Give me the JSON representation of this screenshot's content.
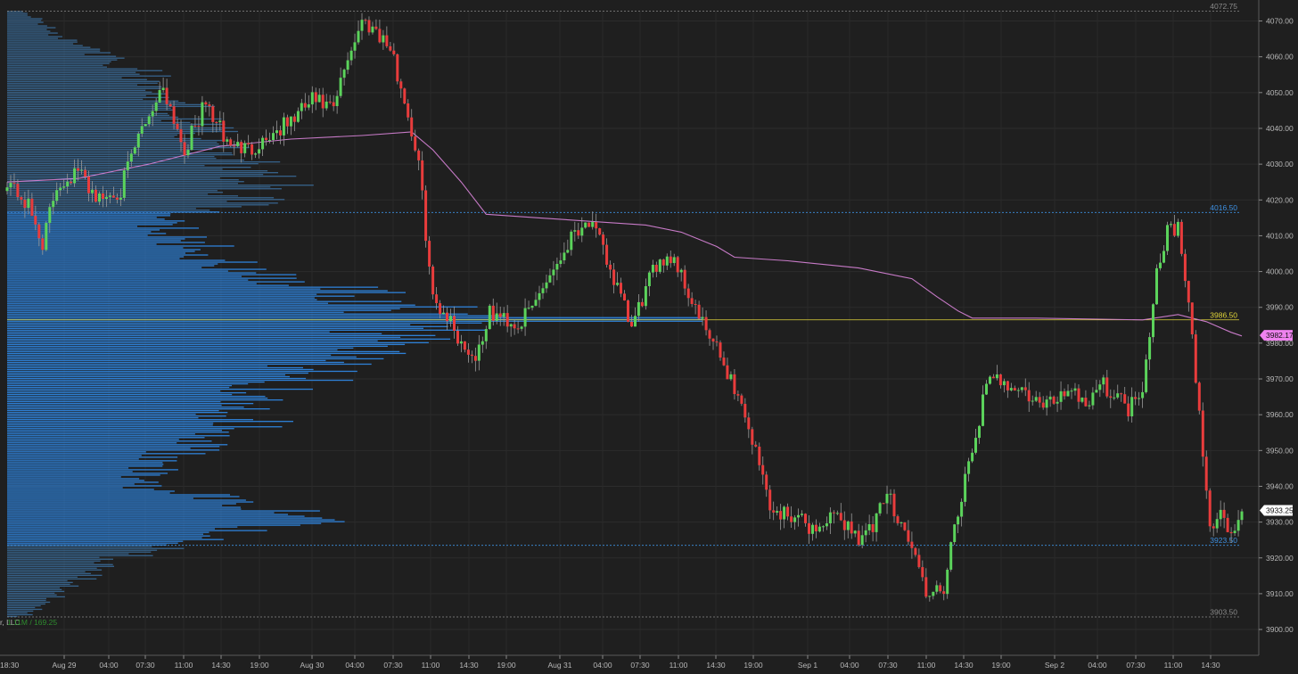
{
  "chart_data": {
    "type": "candlestick",
    "y_range": [
      3898,
      4073
    ],
    "y_ticks": [
      {
        "v": 4070,
        "label": "4070.00"
      },
      {
        "v": 4060,
        "label": "4060.00"
      },
      {
        "v": 4050,
        "label": "4050.00"
      },
      {
        "v": 4040,
        "label": "4040.00"
      },
      {
        "v": 4030,
        "label": "4030.00"
      },
      {
        "v": 4020,
        "label": "4020.00"
      },
      {
        "v": 4010,
        "label": "4010.00"
      },
      {
        "v": 4000,
        "label": "4000.00"
      },
      {
        "v": 3990,
        "label": "3990.00"
      },
      {
        "v": 3980,
        "label": "3980.00"
      },
      {
        "v": 3970,
        "label": "3970.00"
      },
      {
        "v": 3960,
        "label": "3960.00"
      },
      {
        "v": 3950,
        "label": "3950.00"
      },
      {
        "v": 3940,
        "label": "3940.00"
      },
      {
        "v": 3930,
        "label": "3930.00"
      },
      {
        "v": 3920,
        "label": "3920.00"
      },
      {
        "v": 3910,
        "label": "3910.00"
      },
      {
        "v": 3900,
        "label": "3900.00"
      }
    ],
    "x_labels": [
      "Aug 29",
      "04:00",
      "07:30",
      "11:00",
      "14:30",
      "19:00",
      "Aug 30",
      "04:00",
      "07:30",
      "11:00",
      "14:30",
      "19:00",
      "Aug 31",
      "04:00",
      "07:30",
      "11:00",
      "14:30",
      "19:00",
      "Sep 1",
      "04:00",
      "07:30",
      "11:00",
      "14:30",
      "19:00",
      "Sep 2",
      "04:00",
      "07:30",
      "11:00",
      "14:30"
    ],
    "x_start_label": "18:30",
    "levels": [
      {
        "name": "high",
        "value": 4072.75,
        "label": "4072.75",
        "color": "#8a8a8a"
      },
      {
        "name": "value-area-high",
        "value": 4016.5,
        "label": "4016.50",
        "color": "#3d8fe0"
      },
      {
        "name": "point-of-control",
        "value": 3986.5,
        "label": "3986.50",
        "color": "#e0d43a"
      },
      {
        "name": "value-area-low",
        "value": 3923.5,
        "label": "3923.50",
        "color": "#3d8fe0"
      },
      {
        "name": "low",
        "value": 3903.5,
        "label": "3903.50",
        "color": "#8a8a8a"
      }
    ],
    "last_prices": [
      {
        "value": 3982.17,
        "label": "3982.17",
        "color": "#ee82ee"
      },
      {
        "value": 3933.25,
        "label": "3933.25",
        "color": "#ffffff"
      }
    ],
    "anchors": [
      {
        "i": 0,
        "p": 4026
      },
      {
        "i": 6,
        "p": 4018
      },
      {
        "i": 10,
        "p": 4008
      },
      {
        "i": 14,
        "p": 4024
      },
      {
        "i": 20,
        "p": 4028
      },
      {
        "i": 26,
        "p": 4020
      },
      {
        "i": 32,
        "p": 4023
      },
      {
        "i": 38,
        "p": 4040
      },
      {
        "i": 44,
        "p": 4052
      },
      {
        "i": 50,
        "p": 4034
      },
      {
        "i": 56,
        "p": 4047
      },
      {
        "i": 62,
        "p": 4036
      },
      {
        "i": 68,
        "p": 4034
      },
      {
        "i": 74,
        "p": 4038
      },
      {
        "i": 80,
        "p": 4042
      },
      {
        "i": 86,
        "p": 4048
      },
      {
        "i": 92,
        "p": 4045
      },
      {
        "i": 96,
        "p": 4060
      },
      {
        "i": 100,
        "p": 4070
      },
      {
        "i": 104,
        "p": 4068
      },
      {
        "i": 108,
        "p": 4062
      },
      {
        "i": 112,
        "p": 4048
      },
      {
        "i": 116,
        "p": 4030
      },
      {
        "i": 120,
        "p": 3992
      },
      {
        "i": 124,
        "p": 3988
      },
      {
        "i": 128,
        "p": 3980
      },
      {
        "i": 132,
        "p": 3976
      },
      {
        "i": 136,
        "p": 3988
      },
      {
        "i": 140,
        "p": 3987
      },
      {
        "i": 144,
        "p": 3985
      },
      {
        "i": 148,
        "p": 3990
      },
      {
        "i": 152,
        "p": 3998
      },
      {
        "i": 156,
        "p": 4004
      },
      {
        "i": 160,
        "p": 4012
      },
      {
        "i": 164,
        "p": 4014
      },
      {
        "i": 168,
        "p": 4006
      },
      {
        "i": 172,
        "p": 3995
      },
      {
        "i": 176,
        "p": 3984
      },
      {
        "i": 180,
        "p": 3995
      },
      {
        "i": 184,
        "p": 4004
      },
      {
        "i": 188,
        "p": 4004
      },
      {
        "i": 192,
        "p": 3994
      },
      {
        "i": 196,
        "p": 3985
      },
      {
        "i": 200,
        "p": 3978
      },
      {
        "i": 204,
        "p": 3970
      },
      {
        "i": 208,
        "p": 3960
      },
      {
        "i": 212,
        "p": 3946
      },
      {
        "i": 216,
        "p": 3932
      },
      {
        "i": 220,
        "p": 3933
      },
      {
        "i": 224,
        "p": 3930
      },
      {
        "i": 228,
        "p": 3928
      },
      {
        "i": 232,
        "p": 3931
      },
      {
        "i": 236,
        "p": 3930
      },
      {
        "i": 240,
        "p": 3926
      },
      {
        "i": 244,
        "p": 3928
      },
      {
        "i": 248,
        "p": 3938
      },
      {
        "i": 252,
        "p": 3930
      },
      {
        "i": 256,
        "p": 3920
      },
      {
        "i": 260,
        "p": 3908
      },
      {
        "i": 264,
        "p": 3912
      },
      {
        "i": 268,
        "p": 3932
      },
      {
        "i": 272,
        "p": 3950
      },
      {
        "i": 276,
        "p": 3968
      },
      {
        "i": 280,
        "p": 3970
      },
      {
        "i": 284,
        "p": 3968
      },
      {
        "i": 288,
        "p": 3965
      },
      {
        "i": 292,
        "p": 3962
      },
      {
        "i": 296,
        "p": 3965
      },
      {
        "i": 300,
        "p": 3968
      },
      {
        "i": 304,
        "p": 3963
      },
      {
        "i": 308,
        "p": 3969
      },
      {
        "i": 312,
        "p": 3966
      },
      {
        "i": 316,
        "p": 3962
      },
      {
        "i": 320,
        "p": 3968
      },
      {
        "i": 324,
        "p": 4000
      },
      {
        "i": 327,
        "p": 4012
      },
      {
        "i": 330,
        "p": 4012
      },
      {
        "i": 333,
        "p": 3990
      },
      {
        "i": 336,
        "p": 3960
      },
      {
        "i": 339,
        "p": 3928
      },
      {
        "i": 342,
        "p": 3933
      },
      {
        "i": 345,
        "p": 3926
      },
      {
        "i": 348,
        "p": 3933
      }
    ],
    "vwap": [
      {
        "i": 0,
        "p": 4025
      },
      {
        "i": 20,
        "p": 4026
      },
      {
        "i": 40,
        "p": 4030
      },
      {
        "i": 60,
        "p": 4035
      },
      {
        "i": 80,
        "p": 4037
      },
      {
        "i": 100,
        "p": 4038
      },
      {
        "i": 114,
        "p": 4039
      },
      {
        "i": 120,
        "p": 4034
      },
      {
        "i": 128,
        "p": 4025
      },
      {
        "i": 135,
        "p": 4016
      },
      {
        "i": 150,
        "p": 4015
      },
      {
        "i": 180,
        "p": 4013
      },
      {
        "i": 190,
        "p": 4011
      },
      {
        "i": 200,
        "p": 4007
      },
      {
        "i": 205,
        "p": 4004
      },
      {
        "i": 220,
        "p": 4003
      },
      {
        "i": 240,
        "p": 4001
      },
      {
        "i": 255,
        "p": 3998
      },
      {
        "i": 262,
        "p": 3993
      },
      {
        "i": 268,
        "p": 3989
      },
      {
        "i": 272,
        "p": 3987
      },
      {
        "i": 290,
        "p": 3987
      },
      {
        "i": 320,
        "p": 3986.5
      },
      {
        "i": 330,
        "p": 3988
      },
      {
        "i": 338,
        "p": 3986
      },
      {
        "i": 345,
        "p": 3983
      },
      {
        "i": 348,
        "p": 3982
      }
    ],
    "volume_profile": {
      "value_area": [
        3923.5,
        4016.5
      ],
      "footer_label": "1.11M / 169.25",
      "shape": [
        {
          "p": 3904,
          "w": 25
        },
        {
          "p": 3912,
          "w": 75
        },
        {
          "p": 3920,
          "w": 130
        },
        {
          "p": 3924,
          "w": 200
        },
        {
          "p": 3930,
          "w": 330
        },
        {
          "p": 3935,
          "w": 280
        },
        {
          "p": 3940,
          "w": 150
        },
        {
          "p": 3948,
          "w": 175
        },
        {
          "p": 3956,
          "w": 290
        },
        {
          "p": 3962,
          "w": 250
        },
        {
          "p": 3968,
          "w": 320
        },
        {
          "p": 3976,
          "w": 380
        },
        {
          "p": 3982,
          "w": 440
        },
        {
          "p": 3986.5,
          "w": 520
        },
        {
          "p": 3992,
          "w": 420
        },
        {
          "p": 4000,
          "w": 270
        },
        {
          "p": 4008,
          "w": 210
        },
        {
          "p": 4014,
          "w": 170
        },
        {
          "p": 4018,
          "w": 260
        },
        {
          "p": 4024,
          "w": 300
        },
        {
          "p": 4032,
          "w": 260
        },
        {
          "p": 4040,
          "w": 225
        },
        {
          "p": 4048,
          "w": 195
        },
        {
          "p": 4056,
          "w": 150
        },
        {
          "p": 4064,
          "w": 70
        },
        {
          "p": 4073,
          "w": 20
        }
      ]
    }
  }
}
